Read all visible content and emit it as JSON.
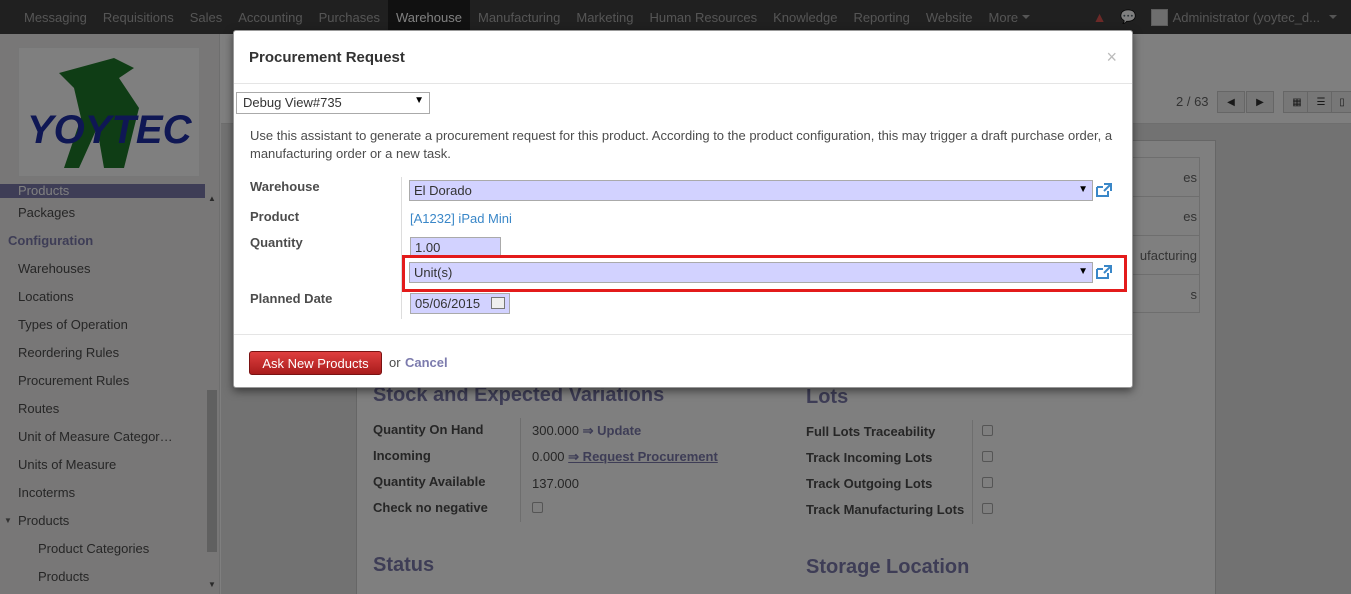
{
  "topbar": {
    "menu": [
      "Messaging",
      "Requisitions",
      "Sales",
      "Accounting",
      "Purchases",
      "Warehouse",
      "Manufacturing",
      "Marketing",
      "Human Resources",
      "Knowledge",
      "Reporting",
      "Website",
      "More"
    ],
    "active": "Warehouse",
    "user": "Administrator (yoytec_d..."
  },
  "sidebar": {
    "logo_text": "YOYTEC COMPUTER",
    "items": {
      "products_top": "Products",
      "packages": "Packages",
      "configuration": "Configuration",
      "warehouses": "Warehouses",
      "locations": "Locations",
      "types_of_operation": "Types of Operation",
      "reordering_rules": "Reordering Rules",
      "procurement_rules": "Procurement Rules",
      "routes": "Routes",
      "uom_categories": "Unit of Measure Categor…",
      "units_of_measure": "Units of Measure",
      "incoterms": "Incoterms",
      "products_group": "Products",
      "product_categories": "Product Categories",
      "products_sub": "Products"
    }
  },
  "control_panel": {
    "pager": "2 / 63"
  },
  "form": {
    "stat_buttons": [
      "es",
      "es",
      "ufacturing",
      "s"
    ],
    "stock_section": "Stock and Expected Variations",
    "qty_on_hand_label": "Quantity On Hand",
    "qty_on_hand_value": "300.000",
    "update_link": "⇒ Update",
    "incoming_label": "Incoming",
    "incoming_value": "0.000",
    "request_link": "⇒ Request Procurement",
    "qty_available_label": "Quantity Available",
    "qty_available_value": "137.000",
    "check_negative_label": "Check no negative",
    "lots_section": "Lots",
    "full_lots_label": "Full Lots Traceability",
    "track_incoming_label": "Track Incoming Lots",
    "track_outgoing_label": "Track Outgoing Lots",
    "track_manufacturing_label": "Track Manufacturing Lots",
    "status_section": "Status",
    "storage_section": "Storage Location"
  },
  "modal": {
    "title": "Procurement Request",
    "close": "×",
    "debug_view": "Debug View#735",
    "help_text": "Use this assistant to generate a procurement request for this product. According to the product configuration, this may trigger a draft purchase order, a manufacturing order or a new task.",
    "warehouse_label": "Warehouse",
    "warehouse_value": "El Dorado",
    "product_label": "Product",
    "product_value": "[A1232] iPad Mini",
    "quantity_label": "Quantity",
    "quantity_value": "1.00",
    "uom_value": "Unit(s)",
    "planned_date_label": "Planned Date",
    "planned_date_value": "05/06/2015",
    "submit_label": "Ask New Products",
    "or_text": "or",
    "cancel_label": "Cancel"
  }
}
